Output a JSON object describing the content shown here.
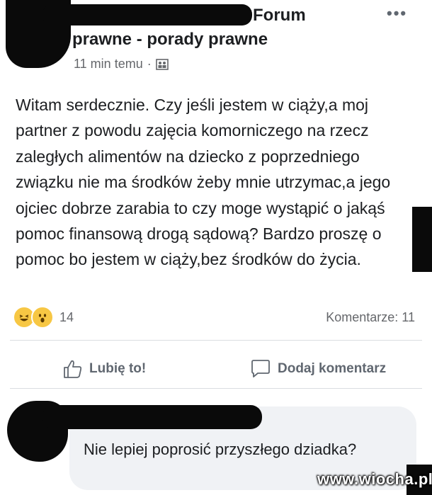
{
  "post": {
    "group_name_line1": "Forum",
    "group_name_line2": "prawne - porady prawne",
    "timestamp": "11 min temu",
    "separator": "·",
    "privacy_icon": "group-icon",
    "more_icon": "more-dots-icon",
    "more_label": "•••",
    "body": "Witam serdecznie. Czy jeśli jestem w ciąży,a moj partner z powodu zajęcia komorniczego na rzecz zaległych alimentów na dziecko z poprzedniego związku nie ma środków żeby mnie utrzymac,a jego ojciec dobrze zarabia to czy moge wystąpić o jakąś pomoc finansową drogą sądową? Bardzo proszę o pomoc bo jestem w ciąży,bez środków do życia."
  },
  "stats": {
    "reaction_icons": [
      "haha-icon",
      "wow-icon"
    ],
    "reaction_count": "14",
    "comments_label": "Komentarze: 11"
  },
  "actions": {
    "like_label": "Lubię to!",
    "comment_label": "Dodaj komentarz"
  },
  "comment": {
    "text": "Nie lepiej poprosić przyszłego dziadka?"
  },
  "watermark": "www.wiocha.pl",
  "colors": {
    "text": "#1c1e21",
    "secondary": "#65676b",
    "bubble": "#f0f2f5",
    "divider": "#dadde1",
    "redaction": "#0a0a0a"
  }
}
